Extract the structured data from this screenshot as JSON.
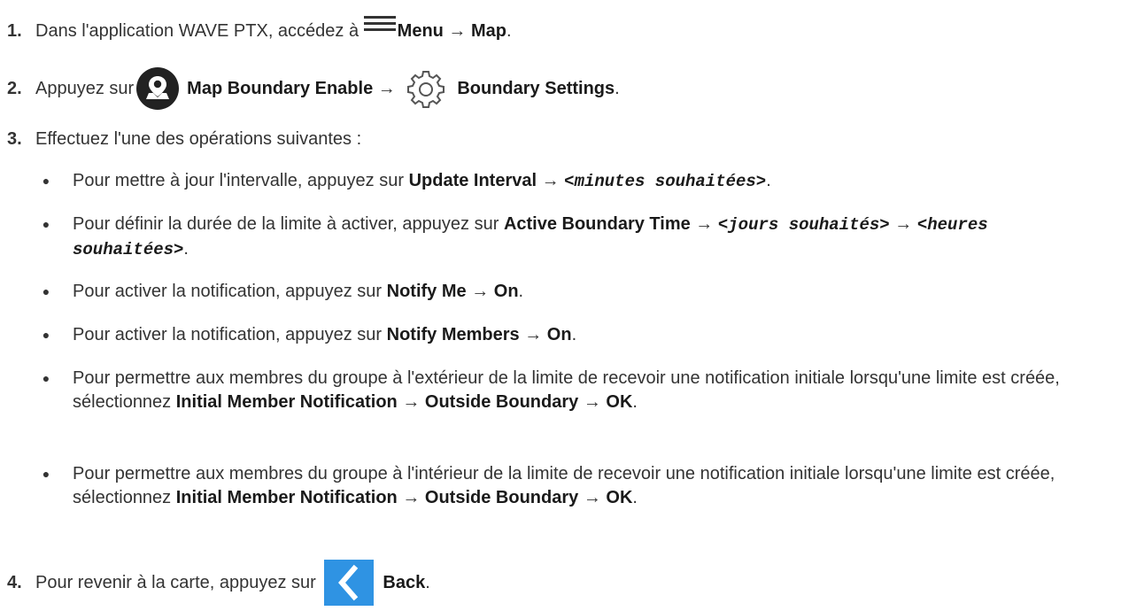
{
  "steps": [
    {
      "number": "1.",
      "prefix": "Dans l'application WAVE PTX, accédez à ",
      "icon": "hamburger-menu-icon",
      "bold1": "Menu",
      "arrow1": " → ",
      "bold2": "Map",
      "end": "."
    },
    {
      "number": "2.",
      "prefix": "Appuyez sur ",
      "icon1": "map-boundary-icon",
      "bold1": "Map Boundary Enable",
      "arrow1": " → ",
      "icon2": "gear-icon",
      "bold2": "Boundary Settings",
      "end": "."
    },
    {
      "number": "3.",
      "text": "Effectuez l'une des opérations suivantes :",
      "bullets": [
        {
          "a": "Pour mettre à jour l'intervalle, appuyez sur ",
          "b1": "Update Interval",
          "arr1": " → ",
          "m1": "<minutes souhaitées>",
          "end": "."
        },
        {
          "a": "Pour définir la durée de la limite à activer, appuyez sur ",
          "b1": "Active Boundary Time",
          "arr1": " → ",
          "m1": "<jours souhaités>",
          "arr2": " → ",
          "m2": "<heures souhaitées>",
          "end": "."
        },
        {
          "a": "Pour activer la notification, appuyez sur ",
          "b1": "Notify Me",
          "arr1": " → ",
          "b2": "On",
          "end": "."
        },
        {
          "a": "Pour activer la notification, appuyez sur ",
          "b1": "Notify Members",
          "arr1": " → ",
          "b2": "On",
          "end": "."
        },
        {
          "a": "Pour permettre aux membres du groupe à l'extérieur de la limite de recevoir une notification initiale lorsqu'une limite est créée, sélectionnez ",
          "b1": "Initial Member Notification",
          "arr1": " → ",
          "b2": "Outside Boundary",
          "arr2": " → ",
          "b3": "OK",
          "end": "."
        },
        {
          "a": "Pour permettre aux membres du groupe à l'intérieur de la limite de recevoir une notification initiale lorsqu'une limite est créée, sélectionnez ",
          "b1": "Initial Member Notification",
          "arr1": " → ",
          "b2": "Outside Boundary",
          "arr2": " → ",
          "b3": "OK",
          "end": "."
        }
      ]
    },
    {
      "number": "4.",
      "prefix": "Pour revenir à la carte, appuyez sur ",
      "icon": "back-chevron-icon",
      "bold1": "Back",
      "end": "."
    }
  ],
  "colors": {
    "text": "#333333",
    "back_button_bg": "#2f93e3",
    "map_icon_bg": "#222222"
  }
}
